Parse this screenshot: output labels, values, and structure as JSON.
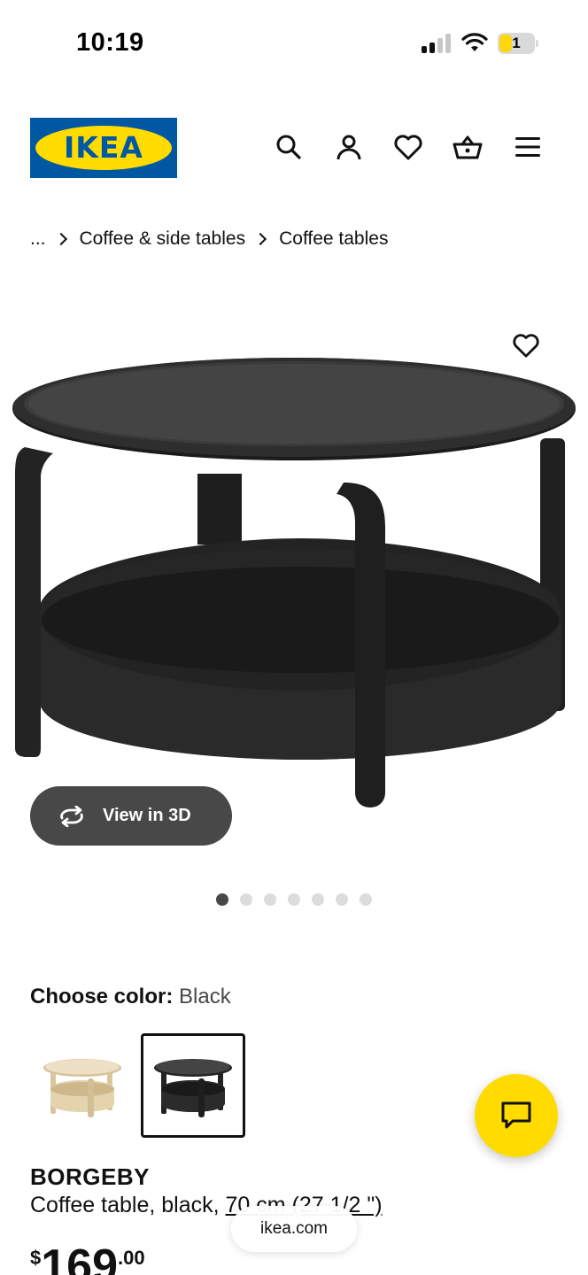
{
  "status_bar": {
    "time": "10:19",
    "battery_level": "1",
    "icons": [
      "signal-icon",
      "wifi-icon",
      "battery-icon"
    ]
  },
  "header": {
    "logo_text": "IKEA",
    "icons": [
      "search-icon",
      "account-icon",
      "heart-icon",
      "basket-icon",
      "menu-icon"
    ],
    "brand_colors": {
      "blue": "#0058a3",
      "yellow": "#ffdb00"
    }
  },
  "breadcrumb": {
    "items": [
      "...",
      "Coffee & side tables",
      "Coffee tables"
    ]
  },
  "gallery": {
    "view_3d_label": "View in 3D",
    "image_count": 7,
    "active_index": 0
  },
  "color_chooser": {
    "label": "Choose color:",
    "selected": "Black",
    "options": [
      "birch",
      "black"
    ]
  },
  "product": {
    "name": "BORGEBY",
    "description": "Coffee table, black, ",
    "size": "70 cm (27 1/2 \")",
    "price_currency": "$",
    "price_integer": "169",
    "price_decimal": ".00"
  },
  "browser": {
    "url": "ikea.com"
  }
}
